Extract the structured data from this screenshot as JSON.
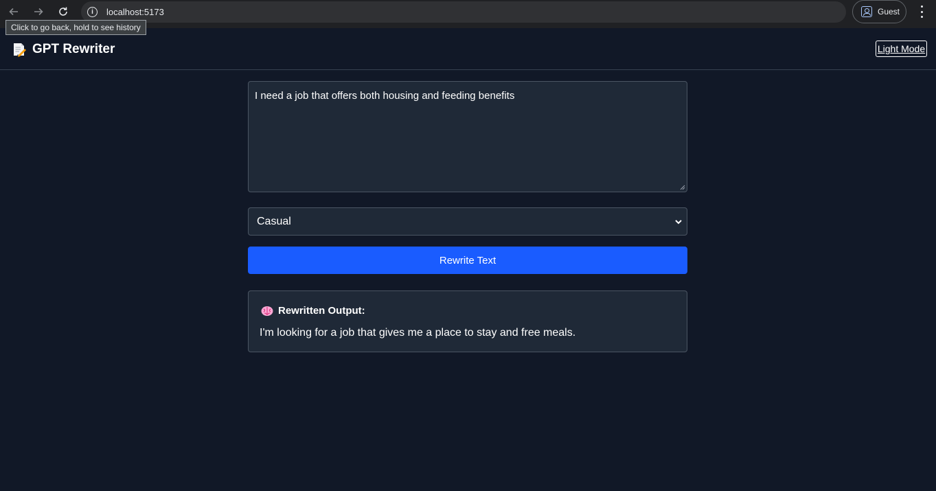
{
  "browser": {
    "url": "localhost:5173",
    "profile_label": "Guest",
    "tooltip": "Click to go back, hold to see history"
  },
  "header": {
    "title": "GPT Rewriter",
    "logo_icon": "memo-icon",
    "theme_toggle_label": "Light Mode"
  },
  "editor": {
    "input_text": "I need a job that offers both housing and feeding benefits",
    "tone_selected": "Casual",
    "rewrite_button_label": "Rewrite Text"
  },
  "output": {
    "heading": "Rewritten Output:",
    "heading_icon": "brain-icon",
    "text": "I'm looking for a job that gives me a place to stay and free meals."
  },
  "colors": {
    "background": "#111827",
    "panel": "#1f2937",
    "accent": "#1a5cff"
  }
}
